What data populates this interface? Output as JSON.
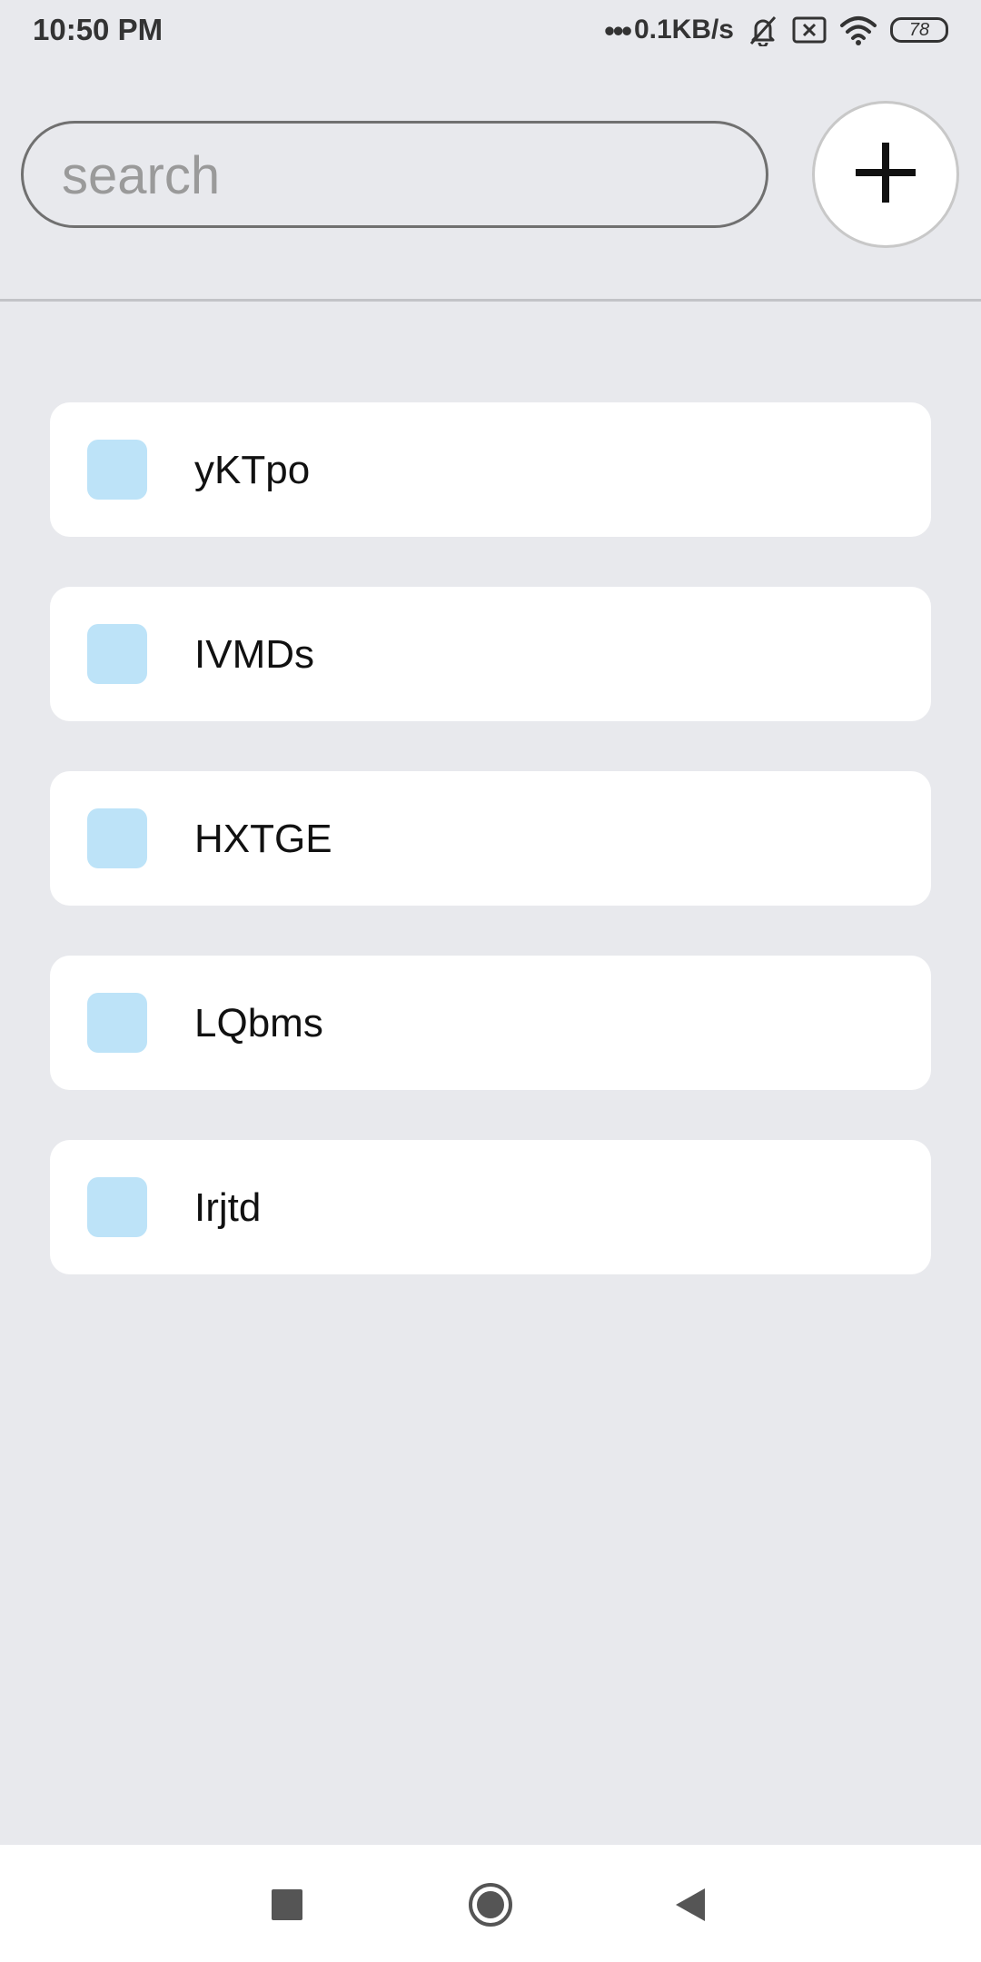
{
  "status_bar": {
    "time": "10:50 PM",
    "dots": "•••",
    "network_speed": "0.1KB/s",
    "battery_level": "78",
    "icons": [
      "muted-bell-icon",
      "sim-error-icon",
      "wifi-icon",
      "battery-icon"
    ]
  },
  "search": {
    "placeholder": "search",
    "value": ""
  },
  "add_button": {
    "icon": "plus-icon"
  },
  "items": [
    {
      "label": "yKTpo",
      "color": "#bde3f8"
    },
    {
      "label": "IVMDs",
      "color": "#bde3f8"
    },
    {
      "label": "HXTGE",
      "color": "#bde3f8"
    },
    {
      "label": "LQbms",
      "color": "#bde3f8"
    },
    {
      "label": "Irjtd",
      "color": "#bde3f8"
    }
  ],
  "nav": {
    "icons": [
      "recents-square-icon",
      "home-circle-icon",
      "back-triangle-icon"
    ]
  },
  "colors": {
    "background": "#e8e9ed",
    "card": "#ffffff",
    "swatch": "#bde3f8"
  }
}
